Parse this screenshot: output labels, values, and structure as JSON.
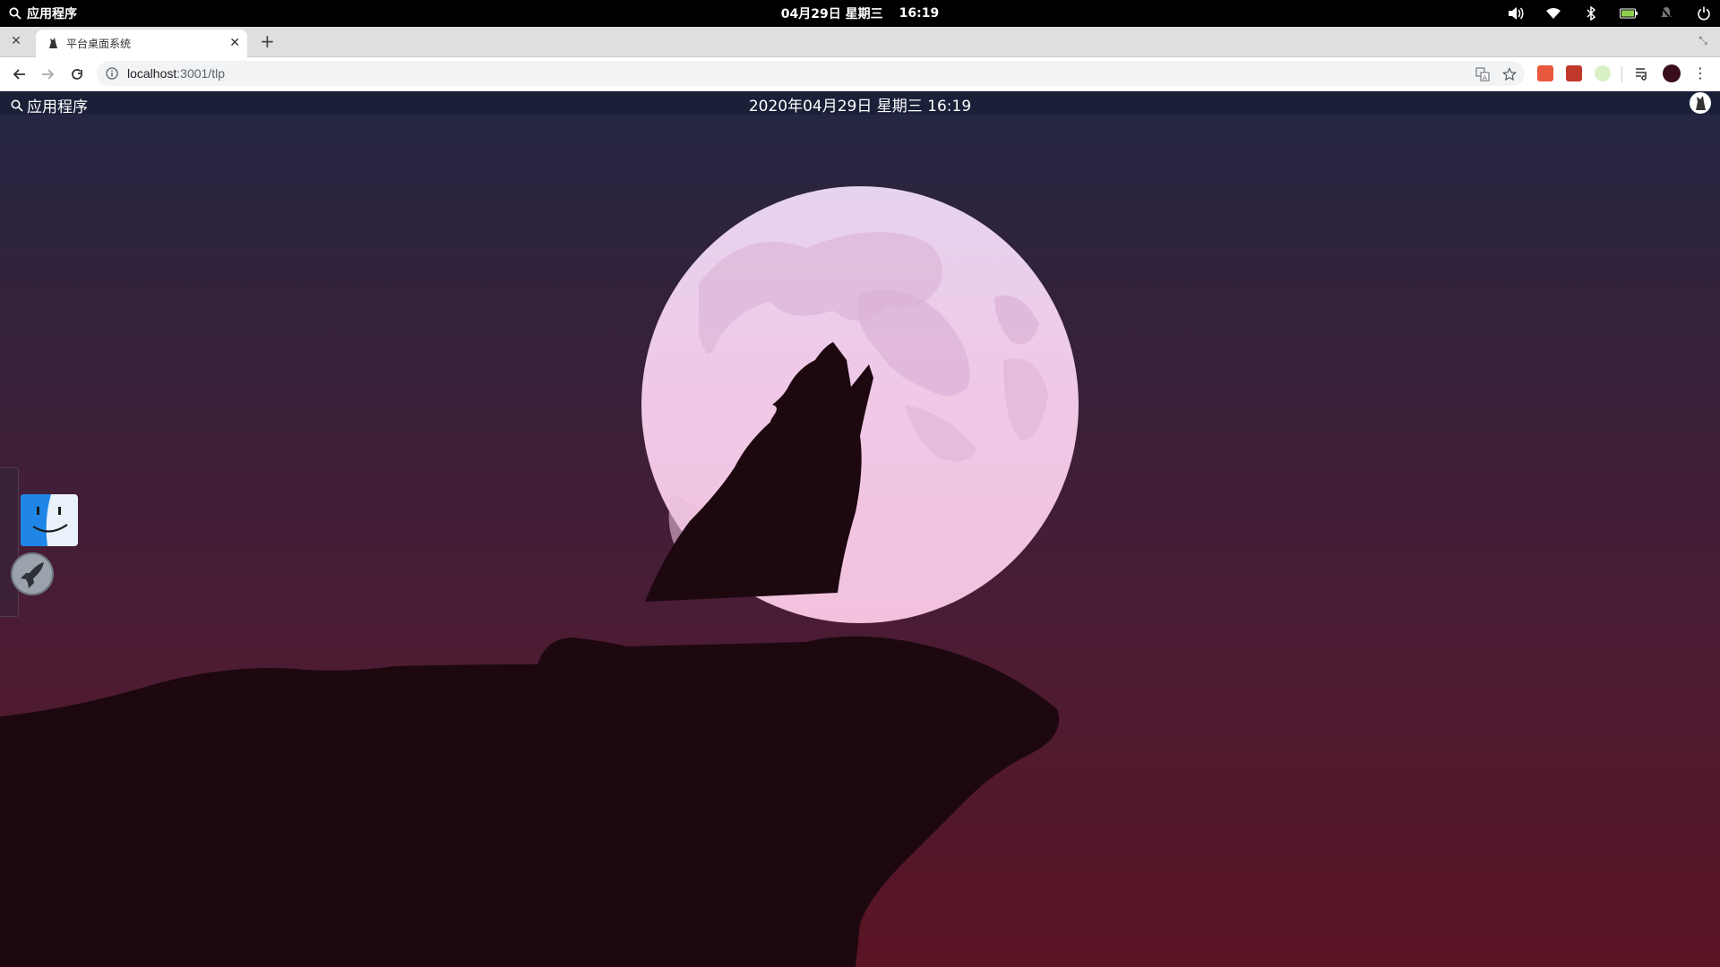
{
  "os_bar": {
    "apps_label": "应用程序",
    "date": "04月29日 星期三",
    "time": "16:19",
    "tray": [
      "volume-icon",
      "wifi-icon",
      "bluetooth-icon",
      "battery-icon",
      "notifications-muted-icon",
      "power-icon"
    ]
  },
  "browser": {
    "tab": {
      "title": "平台桌面系统"
    },
    "url": {
      "host": "localhost",
      "path": ":3001/tlp"
    }
  },
  "desktop": {
    "apps_label": "应用程序",
    "datetime": "2020年04月29日 星期三 16:19",
    "dock": [
      "finder-icon",
      "launchpad-rocket-icon"
    ]
  },
  "colors": {
    "sky_top": "#232642",
    "sky_bottom": "#5a1424",
    "moon": "#f0c8e6",
    "silhouette": "#1d0810"
  }
}
